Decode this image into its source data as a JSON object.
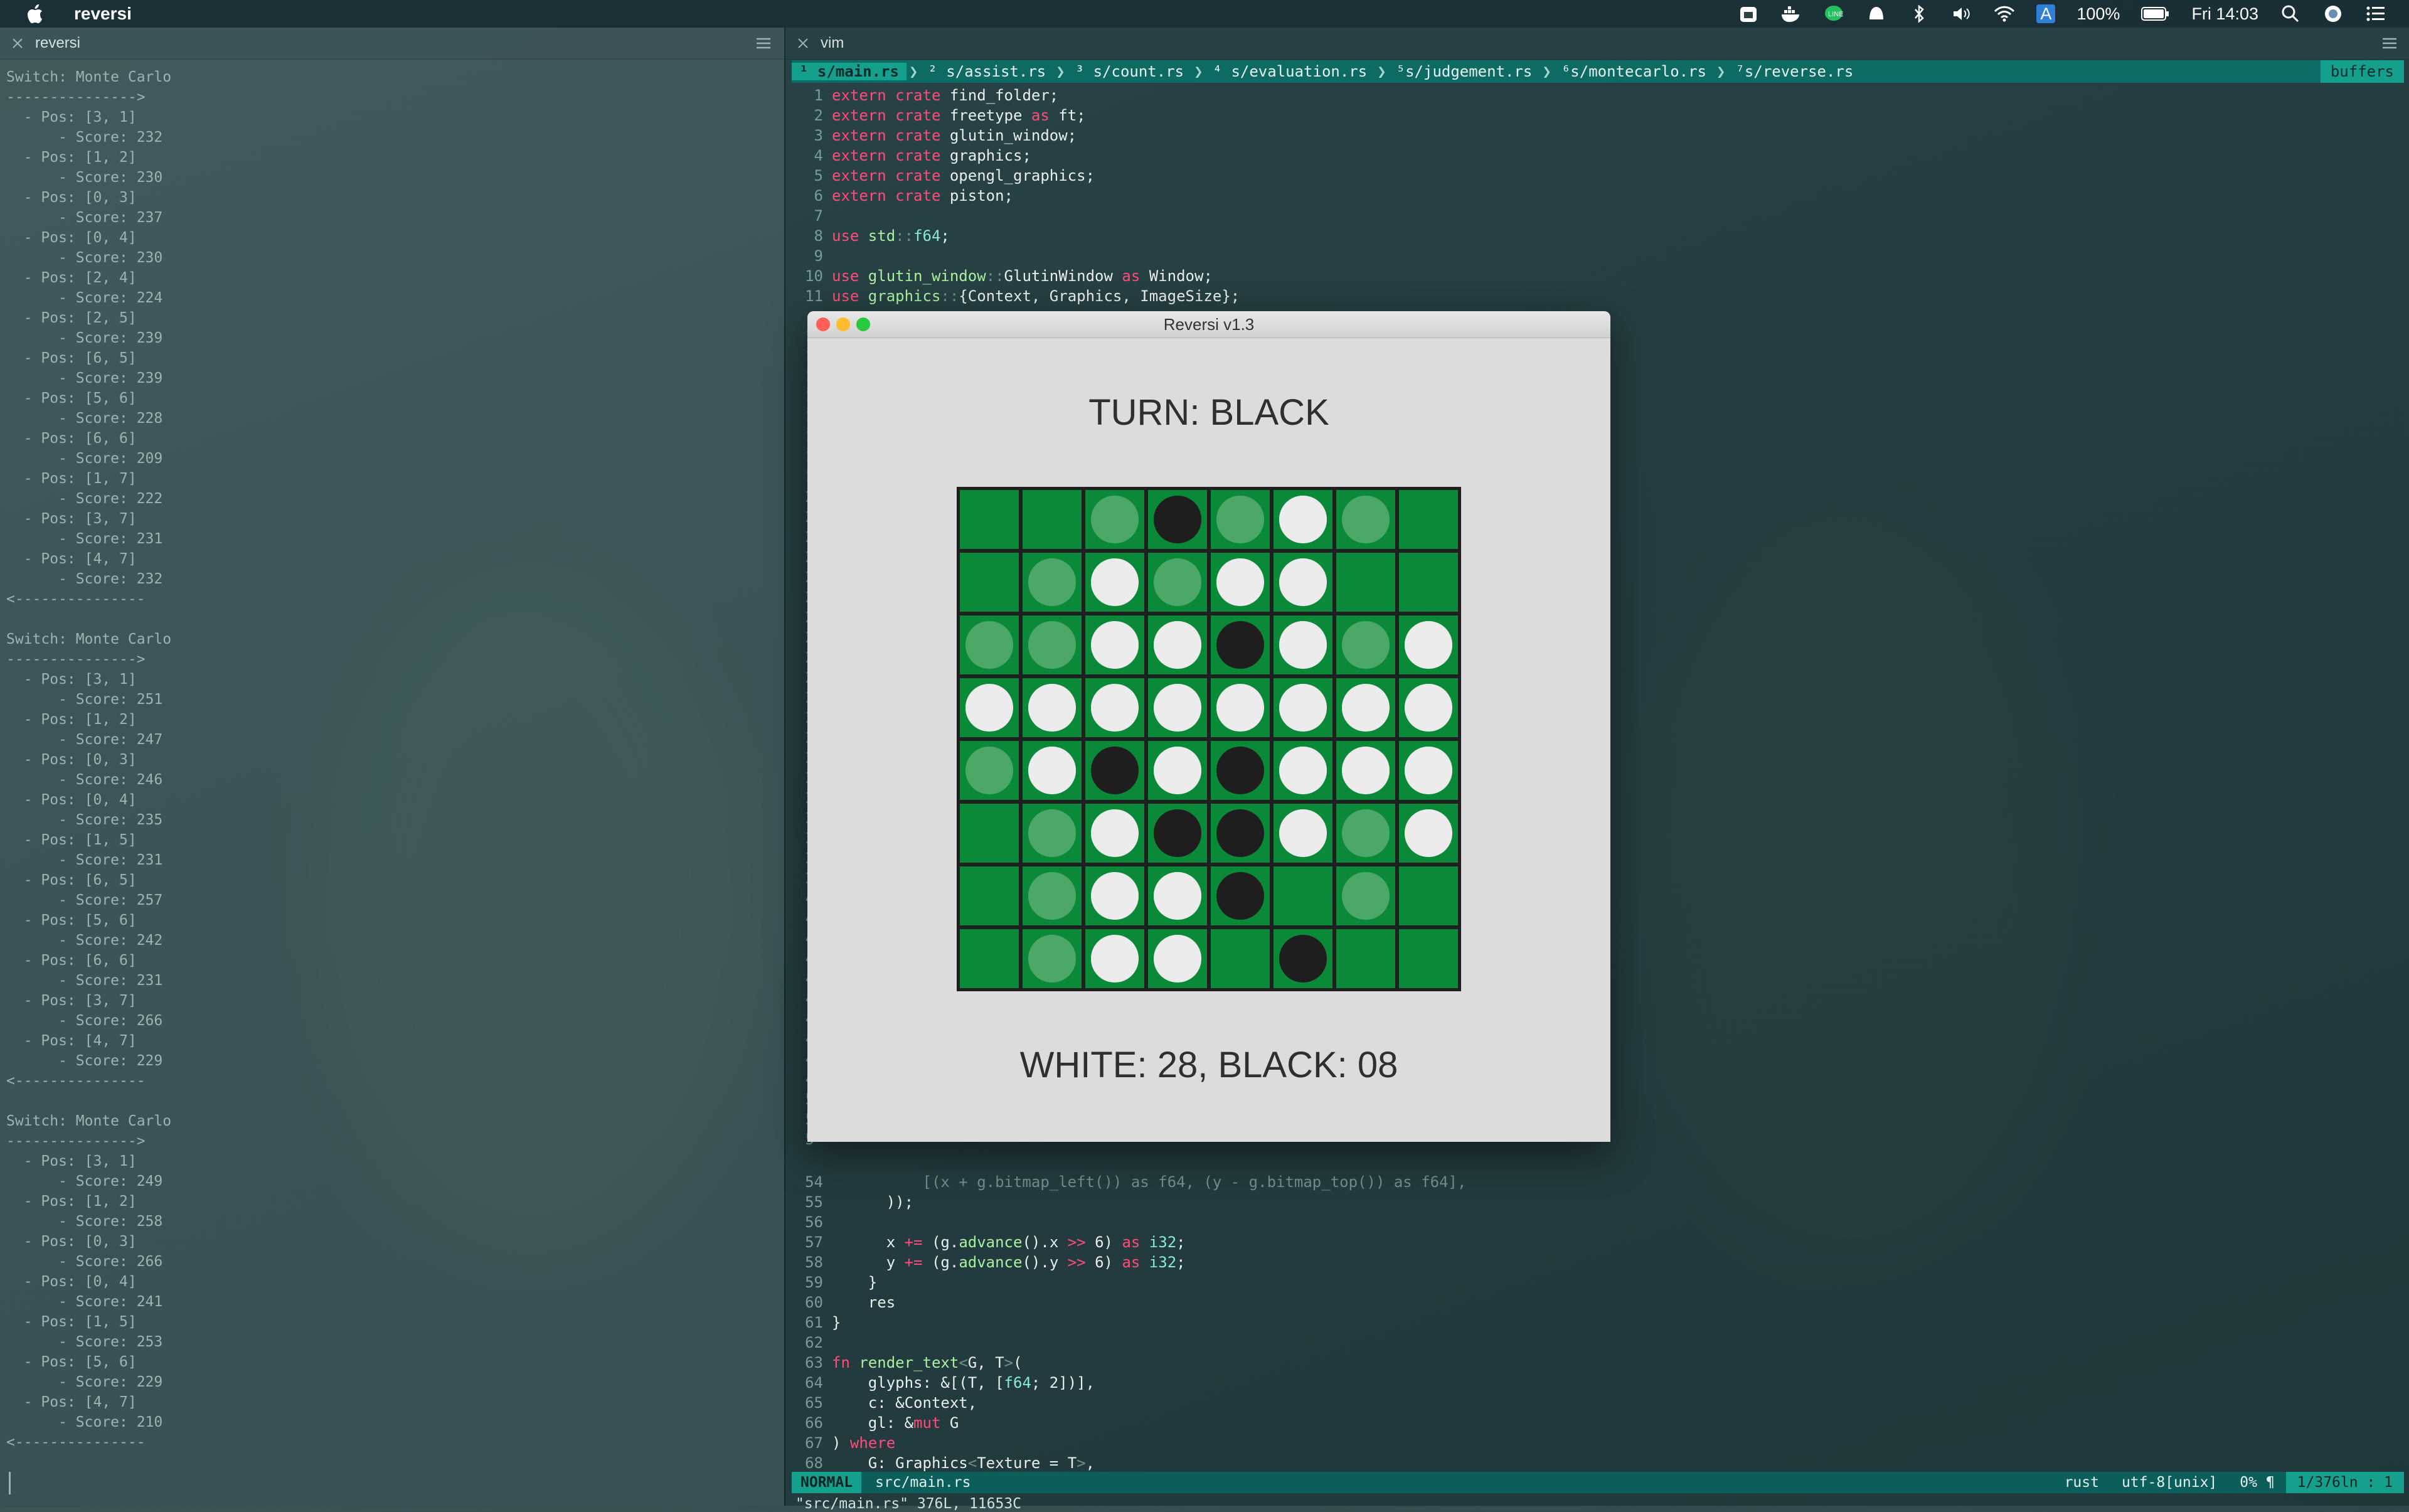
{
  "menubar": {
    "app_name": "reversi",
    "battery": "100%",
    "clock": "Fri 14:03",
    "input_source": "A"
  },
  "left_pane": {
    "tab_title": "reversi",
    "lines": [
      "Switch: Monte Carlo",
      "--------------->",
      "  - Pos: [3, 1]",
      "      - Score: 232",
      "  - Pos: [1, 2]",
      "      - Score: 230",
      "  - Pos: [0, 3]",
      "      - Score: 237",
      "  - Pos: [0, 4]",
      "      - Score: 230",
      "  - Pos: [2, 4]",
      "      - Score: 224",
      "  - Pos: [2, 5]",
      "      - Score: 239",
      "  - Pos: [6, 5]",
      "      - Score: 239",
      "  - Pos: [5, 6]",
      "      - Score: 228",
      "  - Pos: [6, 6]",
      "      - Score: 209",
      "  - Pos: [1, 7]",
      "      - Score: 222",
      "  - Pos: [3, 7]",
      "      - Score: 231",
      "  - Pos: [4, 7]",
      "      - Score: 232",
      "<---------------",
      "",
      "Switch: Monte Carlo",
      "--------------->",
      "  - Pos: [3, 1]",
      "      - Score: 251",
      "  - Pos: [1, 2]",
      "      - Score: 247",
      "  - Pos: [0, 3]",
      "      - Score: 246",
      "  - Pos: [0, 4]",
      "      - Score: 235",
      "  - Pos: [1, 5]",
      "      - Score: 231",
      "  - Pos: [6, 5]",
      "      - Score: 257",
      "  - Pos: [5, 6]",
      "      - Score: 242",
      "  - Pos: [6, 6]",
      "      - Score: 231",
      "  - Pos: [3, 7]",
      "      - Score: 266",
      "  - Pos: [4, 7]",
      "      - Score: 229",
      "<---------------",
      "",
      "Switch: Monte Carlo",
      "--------------->",
      "  - Pos: [3, 1]",
      "      - Score: 249",
      "  - Pos: [1, 2]",
      "      - Score: 258",
      "  - Pos: [0, 3]",
      "      - Score: 266",
      "  - Pos: [0, 4]",
      "      - Score: 241",
      "  - Pos: [1, 5]",
      "      - Score: 253",
      "  - Pos: [5, 6]",
      "      - Score: 229",
      "  - Pos: [4, 7]",
      "      - Score: 210",
      "<---------------"
    ]
  },
  "vim": {
    "tab_title": "vim",
    "tabs": [
      {
        "label": "¹ s/main.rs"
      },
      {
        "label": "² s/assist.rs"
      },
      {
        "label": "³ s/count.rs"
      },
      {
        "label": "⁴ s/evaluation.rs"
      },
      {
        "label": "⁵s/judgement.rs"
      },
      {
        "label": "⁶s/montecarlo.rs"
      },
      {
        "label": "⁷s/reverse.rs"
      }
    ],
    "buffers_label": "buffers",
    "top_lines": [
      {
        "n": "1",
        "parts": [
          [
            "kw",
            "extern crate "
          ],
          [
            "tx",
            "find_folder;"
          ]
        ]
      },
      {
        "n": "2",
        "parts": [
          [
            "kw",
            "extern crate "
          ],
          [
            "tx",
            "freetype "
          ],
          [
            "kw",
            "as "
          ],
          [
            "tx",
            "ft;"
          ]
        ]
      },
      {
        "n": "3",
        "parts": [
          [
            "kw",
            "extern crate "
          ],
          [
            "tx",
            "glutin_window;"
          ]
        ]
      },
      {
        "n": "4",
        "parts": [
          [
            "kw",
            "extern crate "
          ],
          [
            "tx",
            "graphics;"
          ]
        ]
      },
      {
        "n": "5",
        "parts": [
          [
            "kw",
            "extern crate "
          ],
          [
            "tx",
            "opengl_graphics;"
          ]
        ]
      },
      {
        "n": "6",
        "parts": [
          [
            "kw",
            "extern crate "
          ],
          [
            "tx",
            "piston;"
          ]
        ]
      },
      {
        "n": "7",
        "parts": []
      },
      {
        "n": "8",
        "parts": [
          [
            "kw",
            "use "
          ],
          [
            "fnm",
            "std"
          ],
          [
            "cm",
            "::"
          ],
          [
            "ty",
            "f64"
          ],
          [
            "tx",
            ";"
          ]
        ]
      },
      {
        "n": "9",
        "parts": []
      },
      {
        "n": "10",
        "parts": [
          [
            "kw",
            "use "
          ],
          [
            "fnm",
            "glutin_window"
          ],
          [
            "cm",
            "::"
          ],
          [
            "tx",
            "GlutinWindow "
          ],
          [
            "kw",
            "as "
          ],
          [
            "tx",
            "Window;"
          ]
        ]
      },
      {
        "n": "11",
        "parts": [
          [
            "kw",
            "use "
          ],
          [
            "fnm",
            "graphics"
          ],
          [
            "cm",
            "::"
          ],
          [
            "tx",
            "{Context, Graphics, ImageSize};"
          ]
        ]
      }
    ],
    "mid_gutter": [
      "1",
      "1",
      "1",
      "1",
      "1",
      "1",
      "1",
      "1",
      "2",
      "2",
      "2",
      "2",
      "2",
      "2",
      "2",
      "2",
      "2",
      "2",
      "3",
      "3",
      "3",
      "3",
      "3",
      "3",
      "3",
      "3",
      "3",
      "3",
      "4",
      "4",
      "4",
      "4",
      "4",
      "4",
      "4",
      "4",
      "4",
      "4",
      "5",
      "5",
      "5"
    ],
    "bottom_lines": [
      {
        "n": "54",
        "parts": [
          [
            "cm",
            "          [(x + g.bitmap_left()) as f64, (y - g.bitmap_top()) as f64],"
          ]
        ]
      },
      {
        "n": "55",
        "parts": [
          [
            "tx",
            "      ));"
          ]
        ]
      },
      {
        "n": "56",
        "parts": []
      },
      {
        "n": "57",
        "parts": [
          [
            "tx",
            "      x "
          ],
          [
            "kw",
            "+= "
          ],
          [
            "tx",
            "(g."
          ],
          [
            "fnm",
            "advance"
          ],
          [
            "tx",
            "().x "
          ],
          [
            "kw",
            ">> "
          ],
          [
            "tx",
            "6) "
          ],
          [
            "kw",
            "as "
          ],
          [
            "ty",
            "i32"
          ],
          [
            "tx",
            ";"
          ]
        ]
      },
      {
        "n": "58",
        "parts": [
          [
            "tx",
            "      y "
          ],
          [
            "kw",
            "+= "
          ],
          [
            "tx",
            "(g."
          ],
          [
            "fnm",
            "advance"
          ],
          [
            "tx",
            "().y "
          ],
          [
            "kw",
            ">> "
          ],
          [
            "tx",
            "6) "
          ],
          [
            "kw",
            "as "
          ],
          [
            "ty",
            "i32"
          ],
          [
            "tx",
            ";"
          ]
        ]
      },
      {
        "n": "59",
        "parts": [
          [
            "tx",
            "    }"
          ]
        ]
      },
      {
        "n": "60",
        "parts": [
          [
            "tx",
            "    res"
          ]
        ]
      },
      {
        "n": "61",
        "parts": [
          [
            "tx",
            "}"
          ]
        ]
      },
      {
        "n": "62",
        "parts": []
      },
      {
        "n": "63",
        "parts": [
          [
            "kw",
            "fn "
          ],
          [
            "fnm",
            "render_text"
          ],
          [
            "cm",
            "<"
          ],
          [
            "tx",
            "G, T"
          ],
          [
            "cm",
            ">"
          ],
          [
            "tx",
            "("
          ]
        ]
      },
      {
        "n": "64",
        "parts": [
          [
            "tx",
            "    glyphs: &[(T, ["
          ],
          [
            "ty",
            "f64"
          ],
          [
            "tx",
            "; 2])],"
          ]
        ]
      },
      {
        "n": "65",
        "parts": [
          [
            "tx",
            "    c: &Context,"
          ]
        ]
      },
      {
        "n": "66",
        "parts": [
          [
            "tx",
            "    gl: &"
          ],
          [
            "kw",
            "mut "
          ],
          [
            "tx",
            "G"
          ]
        ]
      },
      {
        "n": "67",
        "parts": [
          [
            "tx",
            ") "
          ],
          [
            "kw",
            "where"
          ]
        ]
      },
      {
        "n": "68",
        "parts": [
          [
            "tx",
            "    G: Graphics"
          ],
          [
            "cm",
            "<"
          ],
          [
            "tx",
            "Texture = T"
          ],
          [
            "cm",
            ">"
          ],
          [
            "tx",
            ","
          ]
        ]
      }
    ],
    "status": {
      "mode": "NORMAL",
      "file": "src/main.rs",
      "filetype": "rust",
      "encoding": "utf-8[unix]",
      "percent": "0% ¶",
      "position": "1/376ln : 1"
    },
    "cmdline": "\"src/main.rs\" 376L, 11653C"
  },
  "reversi": {
    "title": "Reversi v1.3",
    "turn": "TURN: BLACK",
    "score": "WHITE: 28, BLACK: 08",
    "board": [
      [
        "e",
        "e",
        "h",
        "b",
        "h",
        "w",
        "h",
        "e"
      ],
      [
        "e",
        "h",
        "w",
        "h",
        "w",
        "w",
        "e",
        "e"
      ],
      [
        "h",
        "h",
        "w",
        "w",
        "b",
        "w",
        "h",
        "w"
      ],
      [
        "w",
        "w",
        "w",
        "w",
        "w",
        "w",
        "w",
        "w"
      ],
      [
        "h",
        "w",
        "b",
        "w",
        "b",
        "w",
        "w",
        "w"
      ],
      [
        "e",
        "h",
        "w",
        "b",
        "b",
        "w",
        "h",
        "w"
      ],
      [
        "e",
        "h",
        "w",
        "w",
        "b",
        "e",
        "h",
        "e"
      ],
      [
        "e",
        "h",
        "w",
        "w",
        "e",
        "b",
        "e",
        "e"
      ]
    ],
    "colors": {
      "cell": "#0a8a39",
      "hint": "#4ca866",
      "white": "#ececec",
      "black": "#1e1e1e"
    }
  }
}
